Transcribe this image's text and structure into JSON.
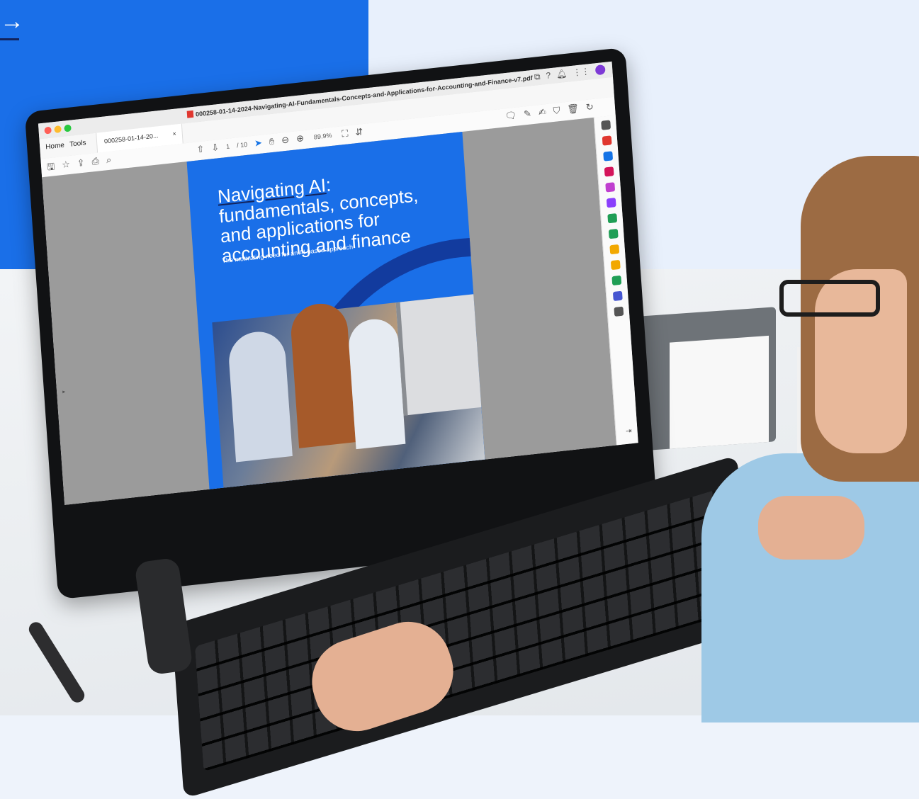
{
  "hero": {
    "arrow_glyph": "→"
  },
  "acrobat": {
    "window_title": "000258-01-14-2024-Navigating-AI-Fundamentals-Concepts-and-Applications-for-Accounting-and-Finance-v7.pdf",
    "tabs": {
      "home": "Home",
      "tools": "Tools",
      "doc": "000258-01-14-20...",
      "close": "×"
    },
    "toolbar": {
      "page_current": "1",
      "page_total": "/ 10",
      "zoom": "89.9%"
    },
    "document_page": {
      "title_part1": "Navigating AI",
      "title_part2": ": fundamentals, concepts, and applications for accounting and finance",
      "subtitle": "The motivating need for an AI-based approach"
    },
    "right_rail_icons": [
      {
        "name": "zoom-in-icon",
        "color": "#555555"
      },
      {
        "name": "export-pdf-icon",
        "color": "#e0372f"
      },
      {
        "name": "comment-icon",
        "color": "#1473e6"
      },
      {
        "name": "organize-icon",
        "color": "#d4145a"
      },
      {
        "name": "fill-sign-icon",
        "color": "#c03fcf"
      },
      {
        "name": "edit-pdf-icon",
        "color": "#8a3ffc"
      },
      {
        "name": "protect-icon",
        "color": "#1f9e55"
      },
      {
        "name": "compress-icon",
        "color": "#1f9e55"
      },
      {
        "name": "export-icon",
        "color": "#f2a800"
      },
      {
        "name": "annotation-icon",
        "color": "#f2a800"
      },
      {
        "name": "print-production-icon",
        "color": "#1f9e55"
      },
      {
        "name": "shield-icon",
        "color": "#4656d1"
      },
      {
        "name": "more-tools-icon",
        "color": "#555555"
      }
    ]
  }
}
